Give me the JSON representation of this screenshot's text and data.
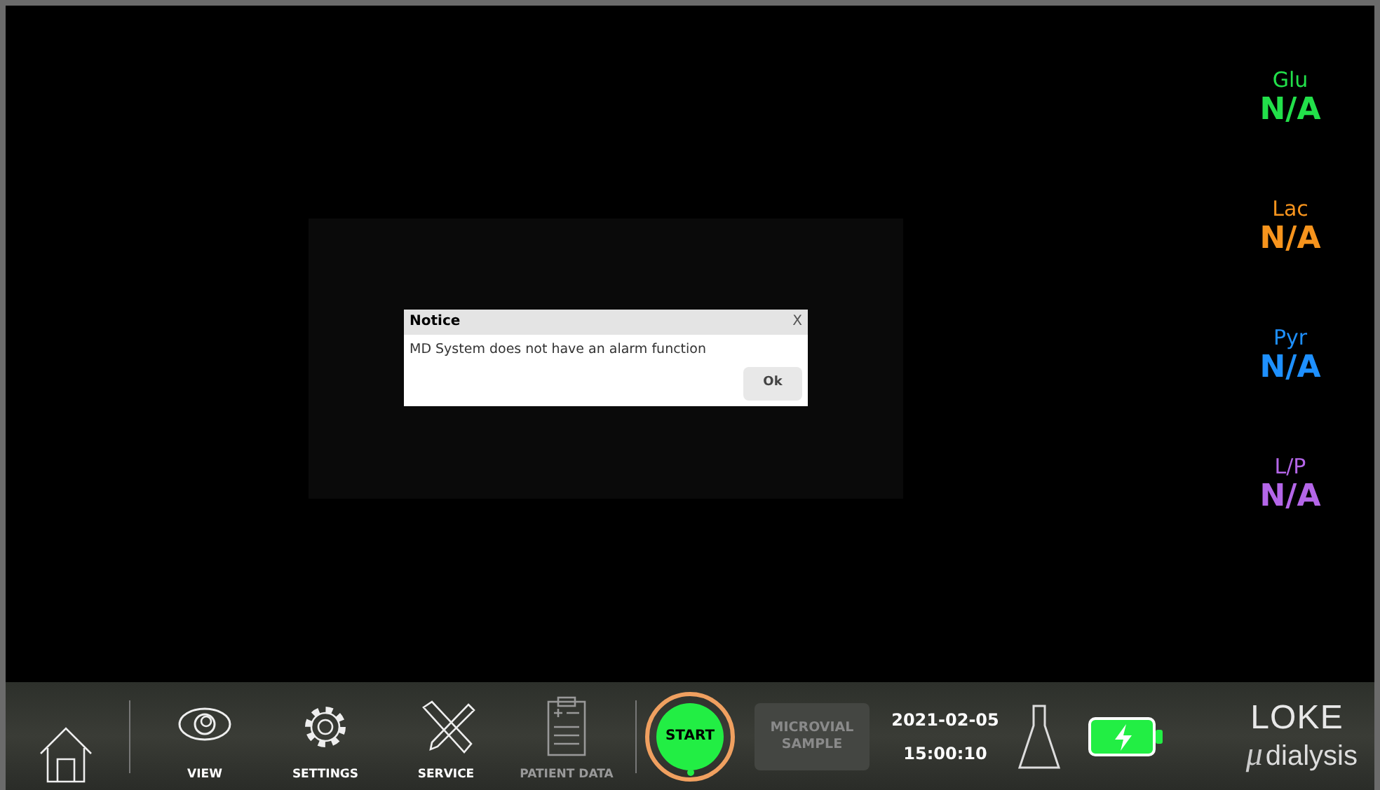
{
  "analytes": [
    {
      "label": "Glu",
      "value": "N/A",
      "color": "#22e04a"
    },
    {
      "label": "Lac",
      "value": "N/A",
      "color": "#f7941d"
    },
    {
      "label": "Pyr",
      "value": "N/A",
      "color": "#1e90ff"
    },
    {
      "label": "L/P",
      "value": "N/A",
      "color": "#b466e8"
    }
  ],
  "dialog": {
    "title": "Notice",
    "close": "X",
    "message": "MD System does not have an alarm function",
    "button": "Ok"
  },
  "toolbar": [
    {
      "kind": "home",
      "disabled": false
    },
    {
      "kind": "view",
      "label": "VIEW",
      "disabled": false
    },
    {
      "kind": "settings",
      "label": "SETTINGS",
      "disabled": false
    },
    {
      "kind": "service",
      "label": "SERVICE",
      "disabled": false
    },
    {
      "kind": "patient",
      "label": "PATIENT DATA",
      "disabled": true
    }
  ],
  "start": {
    "label": "START",
    "highlighted": true
  },
  "sample": {
    "label": "MICROVIAL SAMPLE",
    "disabled": true
  },
  "date": "2021-02-05",
  "time": "15:00:10",
  "battery": {
    "charging": true
  },
  "logo": {
    "name": "LOKE",
    "mu": "μ",
    "sub": "dialysis"
  }
}
